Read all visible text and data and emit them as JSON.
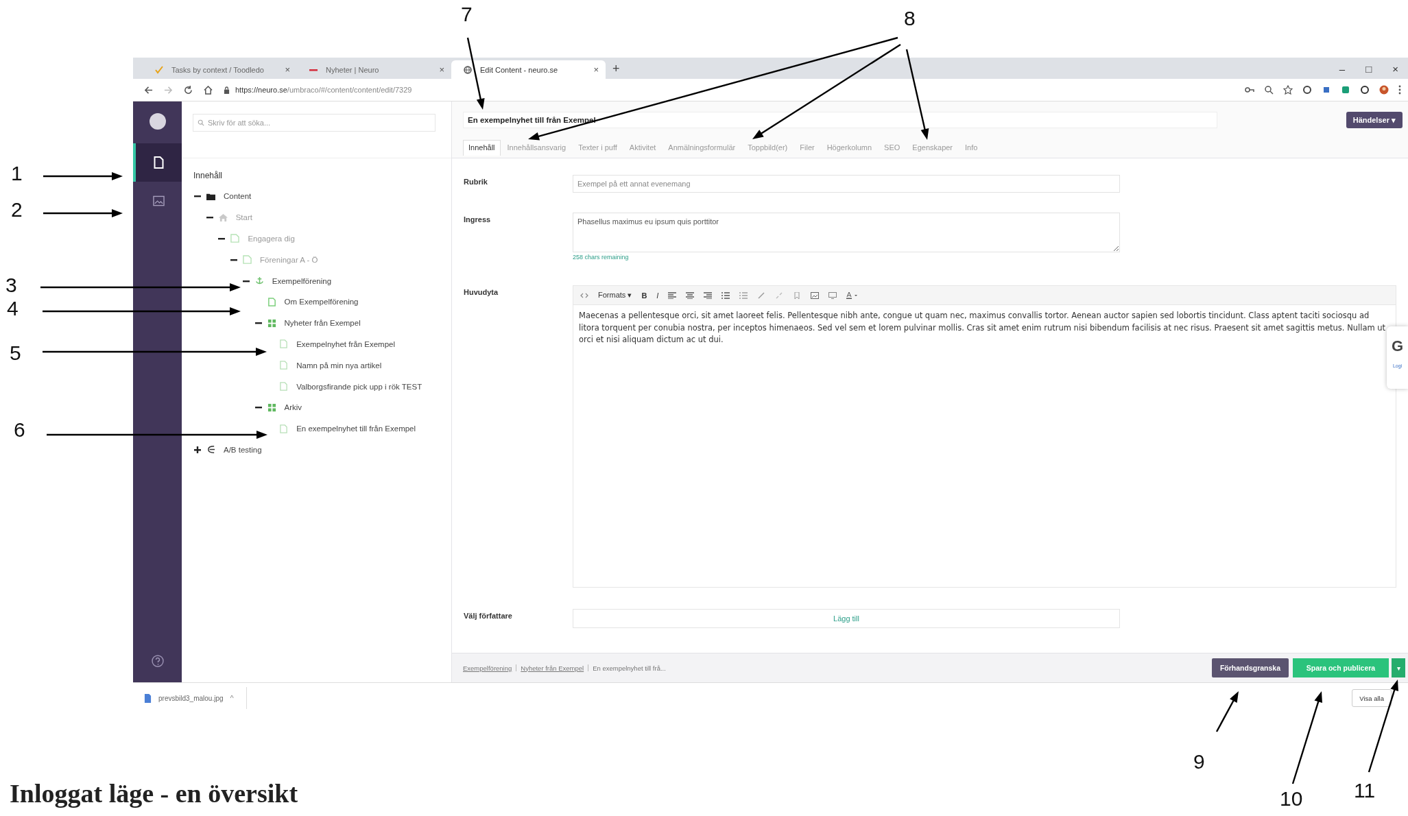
{
  "browser": {
    "tabs": [
      {
        "title": "Tasks by context / Toodledo",
        "close": "×",
        "selected": false
      },
      {
        "title": "Nyheter | Neuro",
        "close": "×",
        "selected": false
      },
      {
        "title": "Edit Content - neuro.se",
        "close": "×",
        "selected": true
      }
    ],
    "new_tab": "+",
    "window_controls": [
      "–",
      "□",
      "×"
    ],
    "url_host": "https://neuro.se",
    "url_path": "/umbraco/#/content/content/edit/7329"
  },
  "sidebar": {
    "items": [
      {
        "kind": "document",
        "selected": true
      },
      {
        "kind": "media",
        "selected": false
      }
    ]
  },
  "tree": {
    "search_placeholder": "Skriv för att söka...",
    "heading": "Innehåll",
    "items": [
      {
        "label": "Content",
        "kind": "folder",
        "faded": false,
        "expanded": true,
        "children": [
          {
            "label": "Start",
            "kind": "home",
            "faded": true,
            "expanded": true,
            "children": [
              {
                "label": "Engagera dig",
                "kind": "section",
                "faded": true,
                "expanded": true,
                "children": [
                  {
                    "label": "Föreningar A - Ö",
                    "kind": "section",
                    "faded": true,
                    "expanded": true,
                    "children": [
                      {
                        "label": "Exempelförening",
                        "kind": "anchor",
                        "faded": false,
                        "expanded": true,
                        "children": [
                          {
                            "label": "Om Exempelförening",
                            "kind": "page",
                            "faded": false
                          },
                          {
                            "label": "Nyheter från Exempel",
                            "kind": "list",
                            "faded": false,
                            "expanded": true,
                            "children": [
                              {
                                "label": "Exempelnyhet från Exempel",
                                "kind": "outline",
                                "faded": false
                              },
                              {
                                "label": "Namn på min nya artikel",
                                "kind": "outline",
                                "faded": false
                              },
                              {
                                "label": "Valborgsfirande pick upp i rök TEST",
                                "kind": "outline",
                                "faded": false
                              }
                            ]
                          },
                          {
                            "label": "Arkiv",
                            "kind": "list",
                            "faded": false,
                            "expanded": true,
                            "children": [
                              {
                                "label": "En exempelnyhet till från Exempel",
                                "kind": "outline",
                                "faded": false
                              }
                            ]
                          }
                        ]
                      }
                    ]
                  }
                ]
              }
            ]
          }
        ]
      },
      {
        "label": "A/B testing",
        "kind": "ab",
        "faded": false,
        "expanded": false
      }
    ]
  },
  "editor": {
    "name": "En exempelnyhet till från Exempel",
    "actions_button": "Händelser ▾",
    "tabs": [
      {
        "label": "Innehåll",
        "selected": true
      },
      {
        "label": "Innehållsansvarig",
        "selected": false
      },
      {
        "label": "Texter i puff",
        "selected": false
      },
      {
        "label": "Aktivitet",
        "selected": false
      },
      {
        "label": "Anmälningsformulär",
        "selected": false
      },
      {
        "label": "Toppbild(er)",
        "selected": false
      },
      {
        "label": "Filer",
        "selected": false
      },
      {
        "label": "Högerkolumn",
        "selected": false
      },
      {
        "label": "SEO",
        "selected": false
      },
      {
        "label": "Egenskaper",
        "selected": false
      },
      {
        "label": "Info",
        "selected": false
      }
    ],
    "fields": [
      {
        "kind": "text",
        "label": "Rubrik",
        "placeholder": "Exempel på ett annat evenemang"
      },
      {
        "kind": "textarea",
        "label": "Ingress",
        "value": "Phasellus maximus eu ipsum quis porttitor",
        "hint": "258 chars remaining"
      },
      {
        "kind": "richtext",
        "label": "Huvudyta",
        "formats": "Formats ▾",
        "bold": "B",
        "italic": "I",
        "value": "Maecenas a pellentesque orci, sit amet laoreet felis. Pellentesque nibh ante, congue ut quam nec, maximus convallis tortor. Aenean auctor sapien sed lobortis tincidunt. Class aptent taciti sociosqu ad litora torquent per conubia nostra, per inceptos himenaeos. Sed vel sem et lorem pulvinar mollis. Cras sit amet enim rutrum nisi bibendum facilisis at nec risus. Praesent sit amet sagittis metus. Nullam ut orci et nisi aliquam dictum ac ut dui."
      },
      {
        "kind": "picker",
        "label": "Välj författare",
        "button": "Lägg till"
      }
    ]
  },
  "footer": {
    "breadcrumb": [
      "Exempelförening",
      "Nyheter från Exempel",
      "En exempelnyhet till frå..."
    ],
    "preview": "Förhandsgranska",
    "publish": "Spara och publicera",
    "publish_caret": "▾"
  },
  "widget": {
    "letter": "G",
    "text": "Logi"
  },
  "downloads": {
    "file": "prevsbild3_malou.jpg",
    "caret": "^",
    "show_all": "Visa alla"
  },
  "annotations": [
    {
      "label": "1"
    },
    {
      "label": "2"
    },
    {
      "label": "3"
    },
    {
      "label": "4"
    },
    {
      "label": "5"
    },
    {
      "label": "6"
    },
    {
      "label": "7"
    },
    {
      "label": "8"
    },
    {
      "label": "9"
    },
    {
      "label": "10"
    },
    {
      "label": "11"
    }
  ],
  "title": "Inloggat läge - en översikt"
}
